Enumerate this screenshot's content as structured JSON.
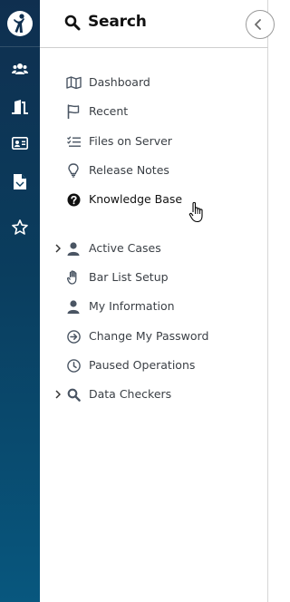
{
  "header": {
    "title": "Search",
    "search_icon": "search-icon",
    "collapse_icon": "chevron-left-icon"
  },
  "rail": {
    "logo": "person-logo",
    "items": [
      {
        "icon": "users-icon"
      },
      {
        "icon": "door-icon"
      },
      {
        "icon": "id-card-icon"
      },
      {
        "icon": "document-icon"
      },
      {
        "icon": "star-icon"
      }
    ]
  },
  "menu": {
    "items": [
      {
        "label": "Dashboard",
        "icon": "map-icon"
      },
      {
        "label": "Recent",
        "icon": "flag-icon"
      },
      {
        "label": "Files on Server",
        "icon": "checklist-icon"
      },
      {
        "label": "Release Notes",
        "icon": "lightbulb-icon"
      },
      {
        "label": "Knowledge Base",
        "icon": "question-circle-icon"
      },
      {
        "label": "Active Cases",
        "icon": "user-icon",
        "expandable": true
      },
      {
        "label": "Bar List Setup",
        "icon": "hand-icon"
      },
      {
        "label": "My Information",
        "icon": "user-icon"
      },
      {
        "label": "Change My Password",
        "icon": "arrow-circle-icon"
      },
      {
        "label": "Paused Operations",
        "icon": "clock-icon"
      },
      {
        "label": "Data Checkers",
        "icon": "search-icon",
        "expandable": true
      }
    ]
  },
  "colors": {
    "rail_top": "#0f2f4f",
    "rail_bottom": "#08577e",
    "icon_gray": "#4a5563",
    "text": "#3a3f45"
  }
}
